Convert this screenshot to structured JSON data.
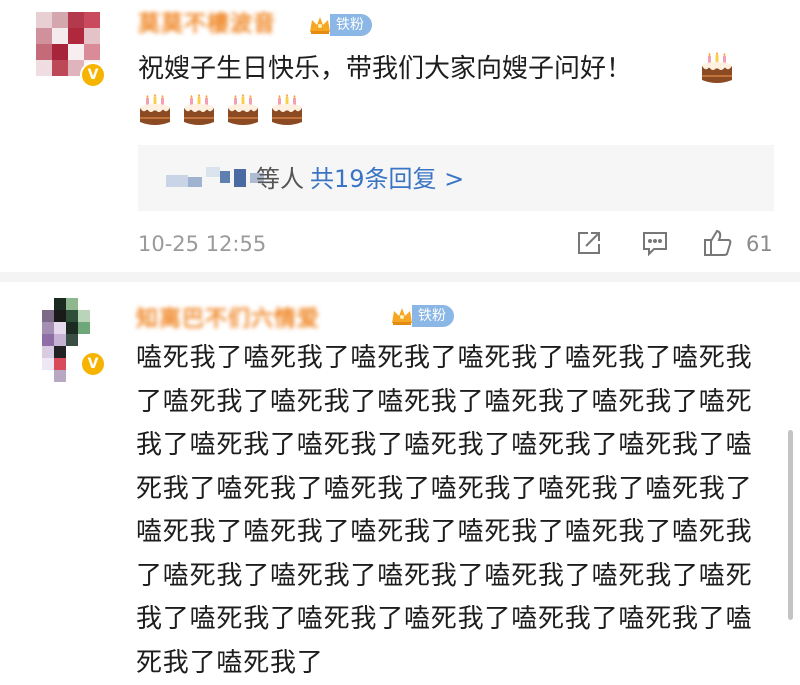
{
  "comments": [
    {
      "username": "莫莫不樓波音",
      "fan_badge": "铁粉",
      "text": "祝嫂子生日快乐，带我们大家向嫂子问好！",
      "reply_people_suffix": "等人",
      "reply_count_label": "共19条回复 >",
      "timestamp": "10-25 12:55",
      "like_count": "61"
    },
    {
      "username": "知离巴不们六情爱",
      "fan_badge": "铁粉",
      "text": "嗑死我了嗑死我了嗑死我了嗑死我了嗑死我了嗑死我了嗑死我了嗑死我了嗑死我了嗑死我了嗑死我了嗑死我了嗑死我了嗑死我了嗑死我了嗑死我了嗑死我了嗑死我了嗑死我了嗑死我了嗑死我了嗑死我了嗑死我了嗑死我了嗑死我了嗑死我了嗑死我了嗑死我了嗑死我了嗑死我了嗑死我了嗑死我了嗑死我了嗑死我了嗑死我了嗑死我了嗑死我了嗑死我了嗑死我了嗑死我了嗑死我了嗑死我了"
    }
  ],
  "icons": {
    "verified": "verified-badge-icon",
    "crown": "crown-icon",
    "cake": "birthday-cake-emoji",
    "share": "share-icon",
    "comment": "comment-icon",
    "like": "thumbs-up-icon"
  },
  "colors": {
    "username": "#f08a2c",
    "fan_badge": "#8ab7e6",
    "link": "#3a74c4",
    "verified": "#f6b400",
    "meta": "#9a9a9a",
    "reply_bg": "#f6f6f6"
  }
}
